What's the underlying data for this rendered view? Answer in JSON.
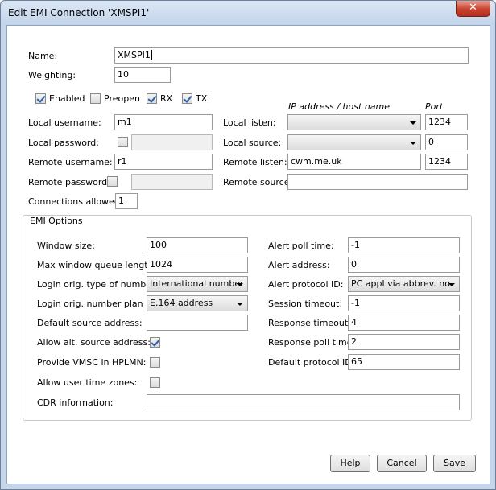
{
  "window": {
    "title": "Edit EMI Connection 'XMSPI1'",
    "close_glyph": "✕"
  },
  "general": {
    "name_label": "Name:",
    "name_value": "XMSPI1",
    "weighting_label": "Weighting:",
    "weighting_value": "10",
    "enabled_label": "Enabled",
    "enabled": true,
    "preopen_label": "Preopen",
    "preopen": false,
    "rx_label": "RX",
    "rx": true,
    "tx_label": "TX",
    "tx": true
  },
  "headers": {
    "ip_host": "IP address / host name",
    "port": "Port"
  },
  "credentials": {
    "local_username_label": "Local username:",
    "local_username_value": "m1",
    "local_password_label": "Local password:",
    "remote_username_label": "Remote username:",
    "remote_username_value": "r1",
    "remote_password_label": "Remote password:",
    "connections_allowed_label": "Connections allowed:",
    "connections_allowed_value": "1"
  },
  "network": {
    "local_listen_label": "Local listen:",
    "local_listen_host": "",
    "local_listen_port": "1234",
    "local_source_label": "Local source:",
    "local_source_host": "",
    "local_source_port": "0",
    "remote_listen_label": "Remote listen:",
    "remote_listen_host": "cwm.me.uk",
    "remote_listen_port": "1234",
    "remote_source_label": "Remote source:",
    "remote_source_host": ""
  },
  "emi_options": {
    "title": "EMI Options",
    "window_size_label": "Window size:",
    "window_size_value": "100",
    "max_queue_label": "Max window queue length:",
    "max_queue_value": "1024",
    "login_ton_label": "Login orig. type of number:",
    "login_ton_value": "International number",
    "login_npi_label": "Login orig. number plan ID:",
    "login_npi_value": "E.164 address",
    "default_source_label": "Default source address:",
    "default_source_value": "",
    "allow_alt_label": "Allow alt. source address:",
    "allow_alt": true,
    "provide_vmsc_label": "Provide VMSC in HPLMN:",
    "provide_vmsc": false,
    "allow_tz_label": "Allow user time zones:",
    "allow_tz": false,
    "cdr_label": "CDR information:",
    "cdr_value": "",
    "alert_poll_label": "Alert poll time:",
    "alert_poll_value": "-1",
    "alert_address_label": "Alert address:",
    "alert_address_value": "0",
    "alert_protocol_label": "Alert protocol ID:",
    "alert_protocol_value": "PC appl via abbrev. no.",
    "session_timeout_label": "Session timeout:",
    "session_timeout_value": "-1",
    "response_timeout_label": "Response timeout:",
    "response_timeout_value": "4",
    "response_poll_label": "Response poll time:",
    "response_poll_value": "2",
    "default_protocol_label": "Default protocol ID:",
    "default_protocol_value": "65"
  },
  "buttons": {
    "help": "Help",
    "cancel": "Cancel",
    "save": "Save"
  }
}
